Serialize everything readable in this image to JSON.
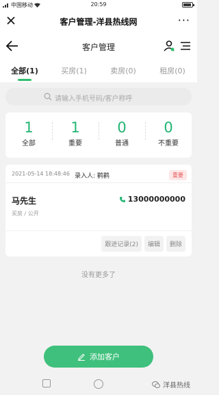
{
  "status": {
    "carrier": "中国移动",
    "time": "20:59"
  },
  "wechat": {
    "title": "客户管理-洋县热线网"
  },
  "nav": {
    "title": "客户管理"
  },
  "tabs": [
    {
      "label": "全部(1)",
      "active": true
    },
    {
      "label": "买房(1)",
      "active": false
    },
    {
      "label": "卖房(0)",
      "active": false
    },
    {
      "label": "租房(0)",
      "active": false
    }
  ],
  "search": {
    "placeholder": "请输入手机号码/客户称呼"
  },
  "stats": [
    {
      "value": "1",
      "label": "全部"
    },
    {
      "value": "1",
      "label": "重要"
    },
    {
      "value": "0",
      "label": "普通"
    },
    {
      "value": "0",
      "label": "不重要"
    }
  ],
  "customer": {
    "datetime": "2021-05-14 18:48:46",
    "recorder": "录入人: 鹳鹳",
    "tag": "重要",
    "name": "马先生",
    "phone": "13000000000",
    "sub": "买房 / 公开",
    "actions": {
      "follow": "跟进记录(2)",
      "edit": "编辑",
      "delete": "删除"
    }
  },
  "no_more": "没有更多了",
  "add_button": "添加客户",
  "watermark": "洋县热线",
  "colors": {
    "accent": "#2ebf6d",
    "tag": "#e85a5a"
  }
}
